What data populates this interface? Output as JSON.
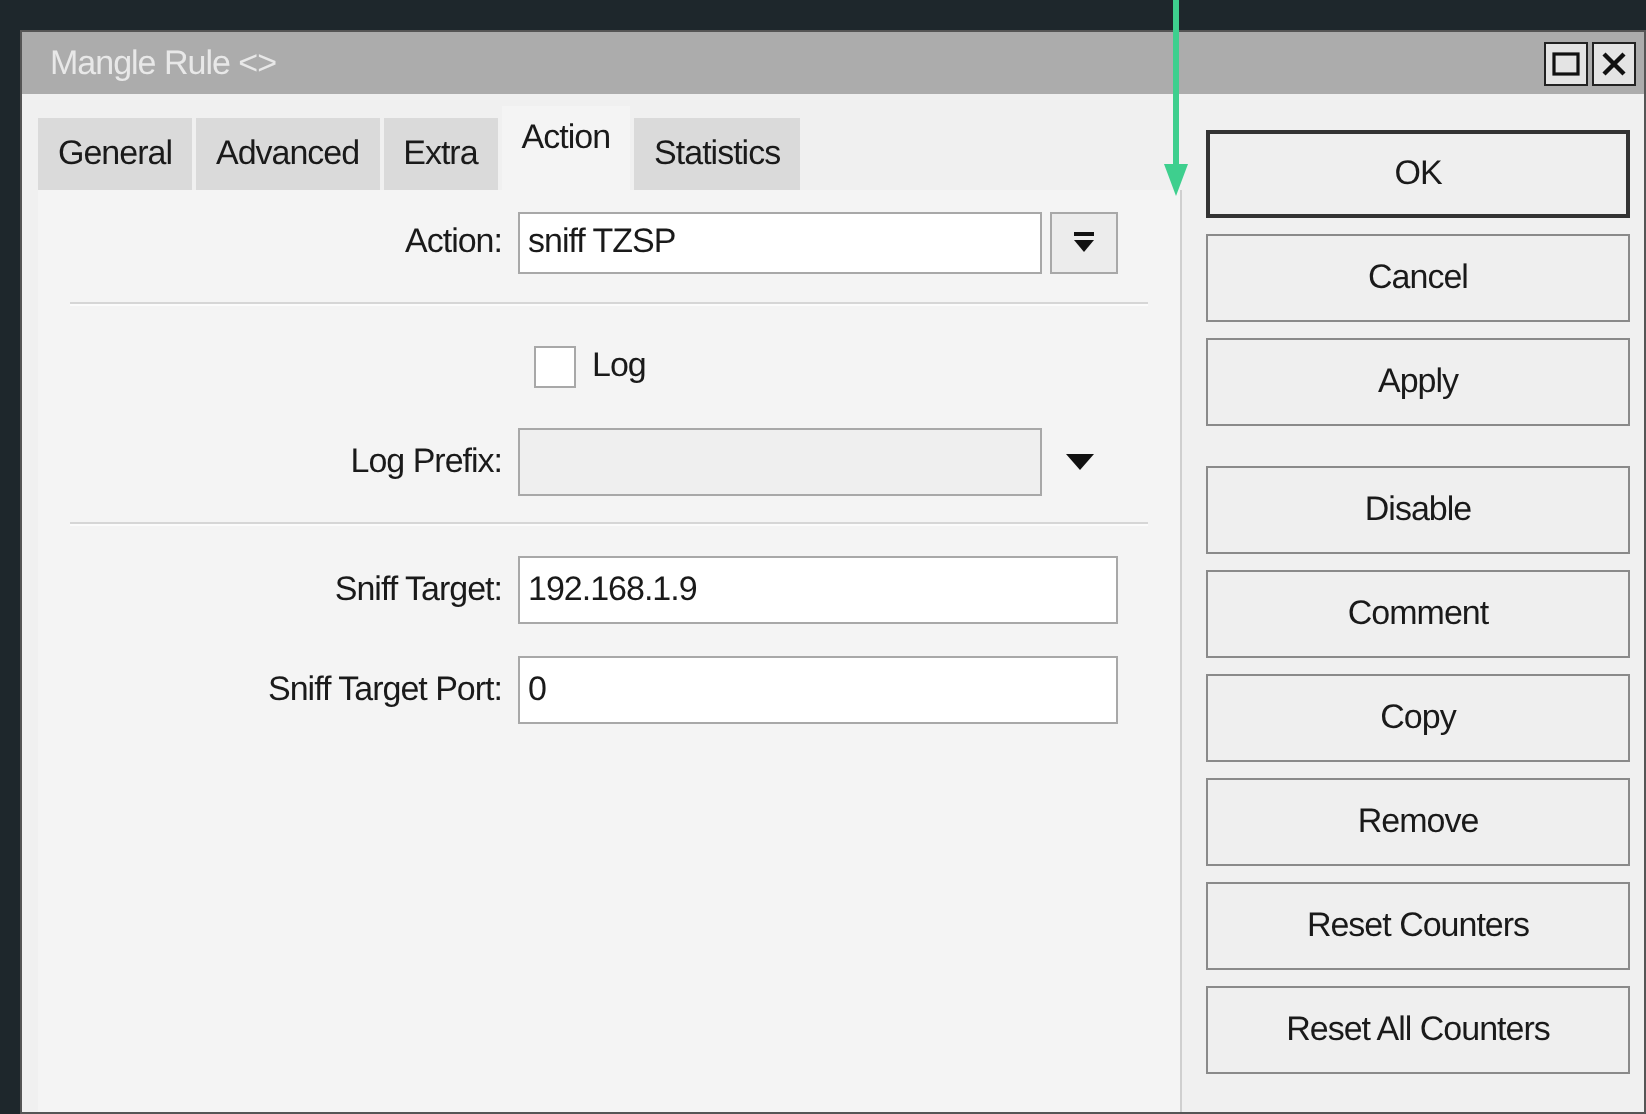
{
  "window": {
    "title": "Mangle Rule <>"
  },
  "tabs": [
    {
      "label": "General",
      "selected": false
    },
    {
      "label": "Advanced",
      "selected": false
    },
    {
      "label": "Extra",
      "selected": false
    },
    {
      "label": "Action",
      "selected": true
    },
    {
      "label": "Statistics",
      "selected": false
    }
  ],
  "form": [
    {
      "kind": "select",
      "label": "Action:",
      "value": "sniff TZSP"
    },
    {
      "kind": "separator"
    },
    {
      "kind": "checkbox",
      "label": "Log",
      "checked": false
    },
    {
      "kind": "combo",
      "label": "Log Prefix:",
      "disabled": true
    },
    {
      "kind": "separator"
    },
    {
      "kind": "text",
      "label": "Sniff Target:",
      "value": "192.168.1.9"
    },
    {
      "kind": "text",
      "label": "Sniff Target Port:",
      "value": "0"
    }
  ],
  "button_groups": [
    [
      {
        "label": "OK",
        "default": true
      },
      {
        "label": "Cancel",
        "default": false
      },
      {
        "label": "Apply",
        "default": false
      }
    ],
    [
      {
        "label": "Disable",
        "default": false
      },
      {
        "label": "Comment",
        "default": false
      },
      {
        "label": "Copy",
        "default": false
      },
      {
        "label": "Remove",
        "default": false
      },
      {
        "label": "Reset Counters",
        "default": false
      },
      {
        "label": "Reset All Counters",
        "default": false
      }
    ]
  ]
}
